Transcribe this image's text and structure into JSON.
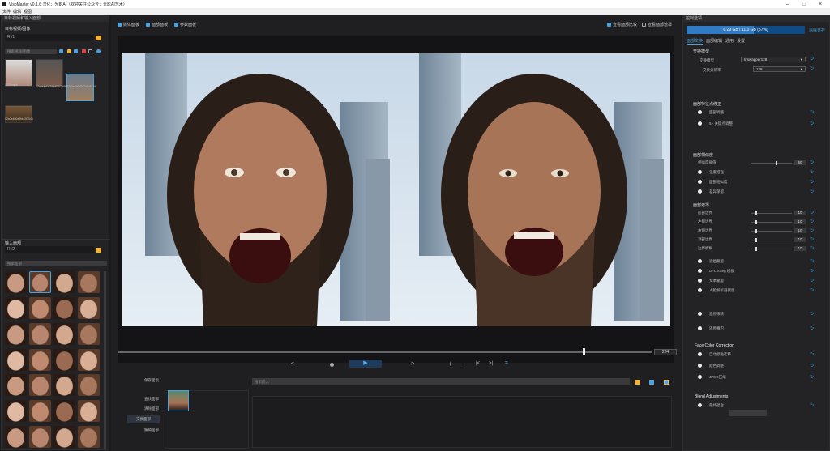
{
  "window": {
    "title": "VisoMaster v0.1.6 汉化：光影AI（欢迎关注公众号：光影AI艺术）"
  },
  "menu": [
    "文件",
    "编辑",
    "视图"
  ],
  "left": {
    "target_header": "目标视频和输入面部",
    "target_group": "目标视频/图像",
    "target_path": "R:/1",
    "search_placeholder": "搜索视频/图像",
    "targets": [
      {
        "label": "1223.mp4"
      },
      {
        "label": "02c0e4b0d29d9021749"
      },
      {
        "label": "02c0e4b0d2c7d2c5116"
      },
      {
        "label": "02c0e4b0d2fd42f7046"
      }
    ],
    "input_group": "输入面部",
    "input_path": "R:/2",
    "face_search_placeholder": "搜索面部"
  },
  "center": {
    "toolbar": {
      "cb1": "媒体面板",
      "cb2": "面部面板",
      "cb3": "参数面板",
      "right1": "查看面部比较",
      "right2": "查看面部遮罩"
    },
    "frame_number": "224",
    "controls": {
      "prev": "<",
      "next": ">",
      "plus": "+",
      "minus": "−",
      "first": "|<",
      "last": ">|"
    },
    "face_actions": [
      "保存面板",
      "查找面部",
      "清除面部",
      "交换面部",
      "编辑面部"
    ],
    "embed_placeholder": "搜索嵌入"
  },
  "right": {
    "header": "控制选项",
    "vram": "6.29 GB / 11.0 GB (57%)",
    "vram_fraction": 0.57,
    "clear_vram": "清除显存",
    "tabs": [
      "面部交换",
      "面部编辑",
      "通用",
      "设置"
    ],
    "swap_section": "交换模型",
    "swap_model_label": "交换模型",
    "swap_model_value": "Inswapper128",
    "swap_res_label": "交换分辨率",
    "swap_res_value": "128",
    "landmark_section": "面部特征点修正",
    "landmark_items": [
      "面部调整",
      "5 - 关键点调整"
    ],
    "similarity_section": "面部相似度",
    "similarity_label": "相似度阈值",
    "similarity_value": "60",
    "similarity_fraction": 0.6,
    "similarity_items": [
      "强度增强",
      "面部相似度",
      "差异保留"
    ],
    "mask_section": "面部遮罩",
    "mask_sliders": [
      {
        "label": "底部边界",
        "value": "10",
        "fraction": 0.1
      },
      {
        "label": "左侧边界",
        "value": "10",
        "fraction": 0.1
      },
      {
        "label": "右侧边界",
        "value": "10",
        "fraction": 0.1
      },
      {
        "label": "顶部边界",
        "value": "10",
        "fraction": 0.1
      },
      {
        "label": "边界模糊",
        "value": "10",
        "fraction": 0.1
      }
    ],
    "mask_items": [
      "遮挡蒙版",
      "DFL XSeg 模板",
      "文本蒙版",
      "人脸解析器蒙版"
    ],
    "extra_items": [
      "还原眼睛",
      "还原嘴巴"
    ],
    "color_section": "Face Color Correction",
    "color_items": [
      "自动颜色迁移",
      "颜色调整",
      "JPEG压缩"
    ],
    "blend_section": "Blend Adjustments",
    "blend_items": [
      "最终混合"
    ]
  }
}
